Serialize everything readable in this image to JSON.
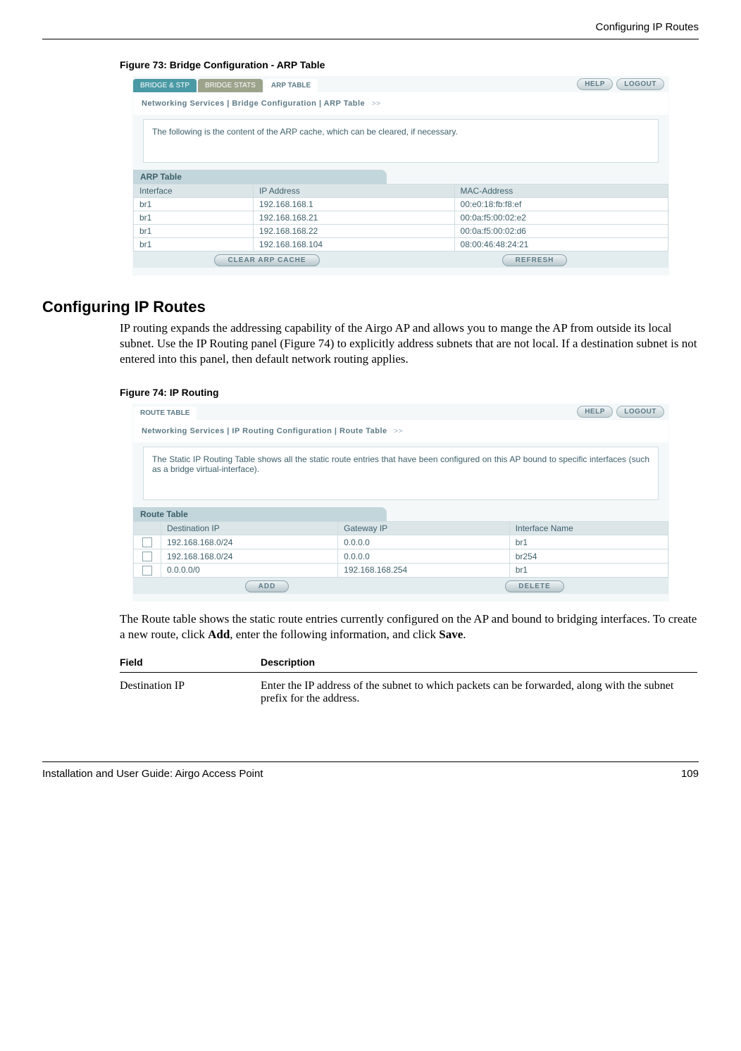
{
  "header": {
    "title": "Configuring IP Routes"
  },
  "fig73": {
    "caption": "Figure 73:      Bridge Configuration - ARP Table",
    "tabs": [
      "BRIDGE & STP",
      "BRIDGE STATS",
      "ARP TABLE"
    ],
    "help": "HELP",
    "logout": "LOGOUT",
    "breadcrumb": "Networking Services | Bridge Configuration | ARP Table",
    "desc": "The following is the content of the ARP cache, which can be cleared, if necessary.",
    "section": "ARP Table",
    "columns": [
      "Interface",
      "IP Address",
      "MAC-Address"
    ],
    "rows": [
      [
        "br1",
        "192.168.168.1",
        "00:e0:18:fb:f8:ef"
      ],
      [
        "br1",
        "192.168.168.21",
        "00:0a:f5:00:02:e2"
      ],
      [
        "br1",
        "192.168.168.22",
        "00:0a:f5:00:02:d6"
      ],
      [
        "br1",
        "192.168.168.104",
        "08:00:46:48:24:21"
      ]
    ],
    "btn_clear": "CLEAR ARP CACHE",
    "btn_refresh": "REFRESH"
  },
  "section": {
    "heading": "Configuring IP Routes",
    "para1": "IP routing expands the addressing capability of the Airgo AP and allows you to mange the AP from outside its local subnet. Use the IP Routing panel (Figure 74) to explicitly address subnets that are not local. If a destination subnet is not entered into this panel, then default network routing applies."
  },
  "fig74": {
    "caption": "Figure 74:      IP Routing",
    "tabs": [
      "ROUTE TABLE"
    ],
    "help": "HELP",
    "logout": "LOGOUT",
    "breadcrumb": "Networking Services | IP Routing Configuration | Route Table",
    "desc": "The Static IP Routing Table shows all the static route entries that have been configured on this AP bound to specific interfaces (such as a bridge virtual-interface).",
    "section": "Route Table",
    "columns": [
      "Destination IP",
      "Gateway IP",
      "Interface Name"
    ],
    "rows": [
      [
        "192.168.168.0/24",
        "0.0.0.0",
        "br1"
      ],
      [
        "192.168.168.0/24",
        "0.0.0.0",
        "br254"
      ],
      [
        "0.0.0.0/0",
        "192.168.168.254",
        "br1"
      ]
    ],
    "btn_add": "ADD",
    "btn_delete": "DELETE"
  },
  "para2_pre": "The Route table shows the static route entries currently configured on the AP and bound to bridging interfaces. To create a new route, click ",
  "para2_add": "Add",
  "para2_mid": ", enter the following information, and click ",
  "para2_save": "Save",
  "para2_end": ".",
  "fieldTable": {
    "head_field": "Field",
    "head_desc": "Description",
    "row_name": "Destination IP",
    "row_desc": "Enter the IP address of the subnet to which packets can be forwarded, along with the subnet prefix for the address."
  },
  "footer": {
    "left": "Installation and User Guide: Airgo Access Point",
    "right": "109"
  }
}
